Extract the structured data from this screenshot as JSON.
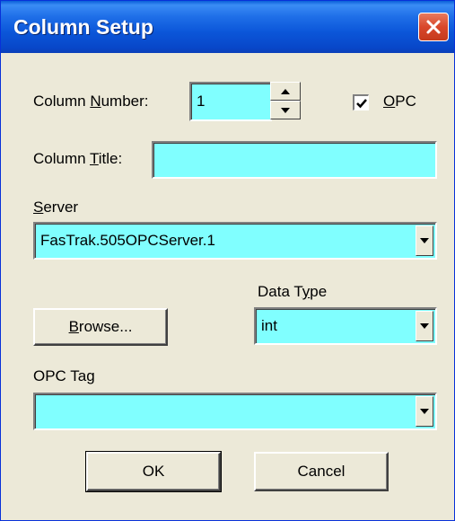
{
  "window": {
    "title": "Column Setup",
    "close_icon": "close-icon"
  },
  "column_number": {
    "label_pre": "Column ",
    "label_ul": "N",
    "label_post": "umber:",
    "value": "1"
  },
  "opc_checkbox": {
    "label_ul": "O",
    "label_post": "PC",
    "checked": true
  },
  "column_title": {
    "label_pre": "Column ",
    "label_ul": "T",
    "label_post": "itle:",
    "value": ""
  },
  "server": {
    "label_ul": "S",
    "label_post": "erver",
    "value": "FasTrak.505OPCServer.1"
  },
  "data_type": {
    "label_pre": "Data T",
    "label_ul": "y",
    "label_post": "pe",
    "value": "int"
  },
  "browse_button": {
    "label_ul": "B",
    "label_post": "rowse..."
  },
  "opc_tag": {
    "label": "OPC Tag",
    "value": ""
  },
  "buttons": {
    "ok": "OK",
    "cancel": "Cancel"
  },
  "colors": {
    "field_bg": "#80ffff",
    "dialog_bg": "#ece9d8",
    "title_bar": "#0b56d9"
  }
}
